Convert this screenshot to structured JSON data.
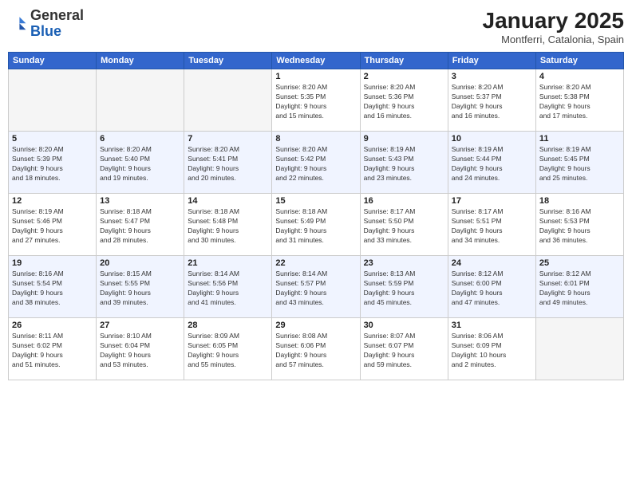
{
  "header": {
    "logo_general": "General",
    "logo_blue": "Blue",
    "month_title": "January 2025",
    "subtitle": "Montferri, Catalonia, Spain"
  },
  "weekdays": [
    "Sunday",
    "Monday",
    "Tuesday",
    "Wednesday",
    "Thursday",
    "Friday",
    "Saturday"
  ],
  "weeks": [
    {
      "id": "week1",
      "days": [
        {
          "num": "",
          "info": ""
        },
        {
          "num": "",
          "info": ""
        },
        {
          "num": "",
          "info": ""
        },
        {
          "num": "1",
          "info": "Sunrise: 8:20 AM\nSunset: 5:35 PM\nDaylight: 9 hours\nand 15 minutes."
        },
        {
          "num": "2",
          "info": "Sunrise: 8:20 AM\nSunset: 5:36 PM\nDaylight: 9 hours\nand 16 minutes."
        },
        {
          "num": "3",
          "info": "Sunrise: 8:20 AM\nSunset: 5:37 PM\nDaylight: 9 hours\nand 16 minutes."
        },
        {
          "num": "4",
          "info": "Sunrise: 8:20 AM\nSunset: 5:38 PM\nDaylight: 9 hours\nand 17 minutes."
        }
      ]
    },
    {
      "id": "week2",
      "days": [
        {
          "num": "5",
          "info": "Sunrise: 8:20 AM\nSunset: 5:39 PM\nDaylight: 9 hours\nand 18 minutes."
        },
        {
          "num": "6",
          "info": "Sunrise: 8:20 AM\nSunset: 5:40 PM\nDaylight: 9 hours\nand 19 minutes."
        },
        {
          "num": "7",
          "info": "Sunrise: 8:20 AM\nSunset: 5:41 PM\nDaylight: 9 hours\nand 20 minutes."
        },
        {
          "num": "8",
          "info": "Sunrise: 8:20 AM\nSunset: 5:42 PM\nDaylight: 9 hours\nand 22 minutes."
        },
        {
          "num": "9",
          "info": "Sunrise: 8:19 AM\nSunset: 5:43 PM\nDaylight: 9 hours\nand 23 minutes."
        },
        {
          "num": "10",
          "info": "Sunrise: 8:19 AM\nSunset: 5:44 PM\nDaylight: 9 hours\nand 24 minutes."
        },
        {
          "num": "11",
          "info": "Sunrise: 8:19 AM\nSunset: 5:45 PM\nDaylight: 9 hours\nand 25 minutes."
        }
      ]
    },
    {
      "id": "week3",
      "days": [
        {
          "num": "12",
          "info": "Sunrise: 8:19 AM\nSunset: 5:46 PM\nDaylight: 9 hours\nand 27 minutes."
        },
        {
          "num": "13",
          "info": "Sunrise: 8:18 AM\nSunset: 5:47 PM\nDaylight: 9 hours\nand 28 minutes."
        },
        {
          "num": "14",
          "info": "Sunrise: 8:18 AM\nSunset: 5:48 PM\nDaylight: 9 hours\nand 30 minutes."
        },
        {
          "num": "15",
          "info": "Sunrise: 8:18 AM\nSunset: 5:49 PM\nDaylight: 9 hours\nand 31 minutes."
        },
        {
          "num": "16",
          "info": "Sunrise: 8:17 AM\nSunset: 5:50 PM\nDaylight: 9 hours\nand 33 minutes."
        },
        {
          "num": "17",
          "info": "Sunrise: 8:17 AM\nSunset: 5:51 PM\nDaylight: 9 hours\nand 34 minutes."
        },
        {
          "num": "18",
          "info": "Sunrise: 8:16 AM\nSunset: 5:53 PM\nDaylight: 9 hours\nand 36 minutes."
        }
      ]
    },
    {
      "id": "week4",
      "days": [
        {
          "num": "19",
          "info": "Sunrise: 8:16 AM\nSunset: 5:54 PM\nDaylight: 9 hours\nand 38 minutes."
        },
        {
          "num": "20",
          "info": "Sunrise: 8:15 AM\nSunset: 5:55 PM\nDaylight: 9 hours\nand 39 minutes."
        },
        {
          "num": "21",
          "info": "Sunrise: 8:14 AM\nSunset: 5:56 PM\nDaylight: 9 hours\nand 41 minutes."
        },
        {
          "num": "22",
          "info": "Sunrise: 8:14 AM\nSunset: 5:57 PM\nDaylight: 9 hours\nand 43 minutes."
        },
        {
          "num": "23",
          "info": "Sunrise: 8:13 AM\nSunset: 5:59 PM\nDaylight: 9 hours\nand 45 minutes."
        },
        {
          "num": "24",
          "info": "Sunrise: 8:12 AM\nSunset: 6:00 PM\nDaylight: 9 hours\nand 47 minutes."
        },
        {
          "num": "25",
          "info": "Sunrise: 8:12 AM\nSunset: 6:01 PM\nDaylight: 9 hours\nand 49 minutes."
        }
      ]
    },
    {
      "id": "week5",
      "days": [
        {
          "num": "26",
          "info": "Sunrise: 8:11 AM\nSunset: 6:02 PM\nDaylight: 9 hours\nand 51 minutes."
        },
        {
          "num": "27",
          "info": "Sunrise: 8:10 AM\nSunset: 6:04 PM\nDaylight: 9 hours\nand 53 minutes."
        },
        {
          "num": "28",
          "info": "Sunrise: 8:09 AM\nSunset: 6:05 PM\nDaylight: 9 hours\nand 55 minutes."
        },
        {
          "num": "29",
          "info": "Sunrise: 8:08 AM\nSunset: 6:06 PM\nDaylight: 9 hours\nand 57 minutes."
        },
        {
          "num": "30",
          "info": "Sunrise: 8:07 AM\nSunset: 6:07 PM\nDaylight: 9 hours\nand 59 minutes."
        },
        {
          "num": "31",
          "info": "Sunrise: 8:06 AM\nSunset: 6:09 PM\nDaylight: 10 hours\nand 2 minutes."
        },
        {
          "num": "",
          "info": ""
        }
      ]
    }
  ]
}
